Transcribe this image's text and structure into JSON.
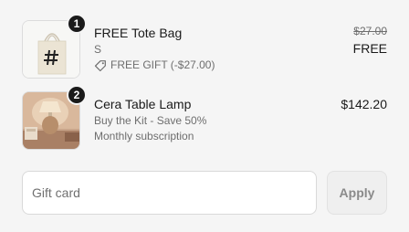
{
  "items": [
    {
      "quantity": "1",
      "name": "FREE Tote Bag",
      "variant": "S",
      "discount_label": "FREE GIFT (-$27.00)",
      "original_price": "$27.00",
      "price": "FREE",
      "icon": "tag-icon"
    },
    {
      "quantity": "2",
      "name": "Cera Table Lamp",
      "line1": "Buy the Kit - Save 50%",
      "line2": "Monthly subscription",
      "price": "$142.20"
    }
  ],
  "gift_card": {
    "placeholder": "Gift card",
    "apply_label": "Apply"
  },
  "colors": {
    "background": "#f5f5f5",
    "badge": "#1a1a1a",
    "muted_text": "#6e6e6e"
  }
}
